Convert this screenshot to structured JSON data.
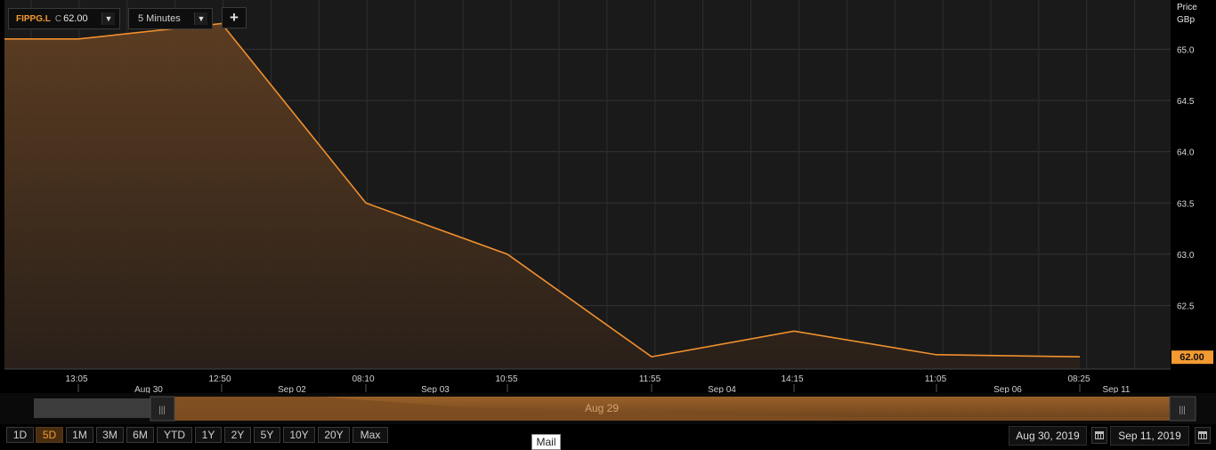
{
  "toolbar": {
    "symbol": "FIPPG.L",
    "quote_prefix": "C",
    "quote_value": "62.00",
    "interval": "5 Minutes",
    "add_label": "+"
  },
  "colors": {
    "accent": "#f39a32",
    "line": "#f0902e",
    "grid": "#333333",
    "plot_bg": "#1a1a1a"
  },
  "axis": {
    "unit_line1": "Price",
    "unit_line2": "GBp",
    "last_price_label": "62.00"
  },
  "chart_data": {
    "type": "area",
    "title": "",
    "ylabel": "Price GBp",
    "ylim": [
      61.88,
      65.48
    ],
    "y_ticks": [
      62.5,
      63.0,
      63.5,
      64.0,
      64.5,
      65.0
    ],
    "y_tick_labels": [
      "62.5",
      "63.0",
      "63.5",
      "64.0",
      "64.5",
      "65.0"
    ],
    "x": [
      "13:05",
      "12:50",
      "08:10",
      "10:55",
      "11:55",
      "14:15",
      "11:05",
      "08:25"
    ],
    "date_labels": [
      "Aug 30",
      "Sep 02",
      "Sep 03",
      "Sep 04",
      "Sep 06",
      "Sep 11"
    ],
    "series": [
      {
        "values": [
          65.1,
          65.1,
          65.25,
          63.5,
          63.0,
          62.0,
          62.25,
          62.02,
          62.0
        ]
      }
    ],
    "last_value": 62.0,
    "grid": true
  },
  "navigator": {
    "label": "Aug 29",
    "handle_glyph": "|||"
  },
  "ranges": [
    "1D",
    "5D",
    "1M",
    "3M",
    "6M",
    "YTD",
    "1Y",
    "2Y",
    "5Y",
    "10Y",
    "20Y",
    "Max"
  ],
  "active_range": "5D",
  "date_range": {
    "start": "Aug 30, 2019",
    "end": "Sep 11, 2019"
  },
  "tooltip": "Mail"
}
